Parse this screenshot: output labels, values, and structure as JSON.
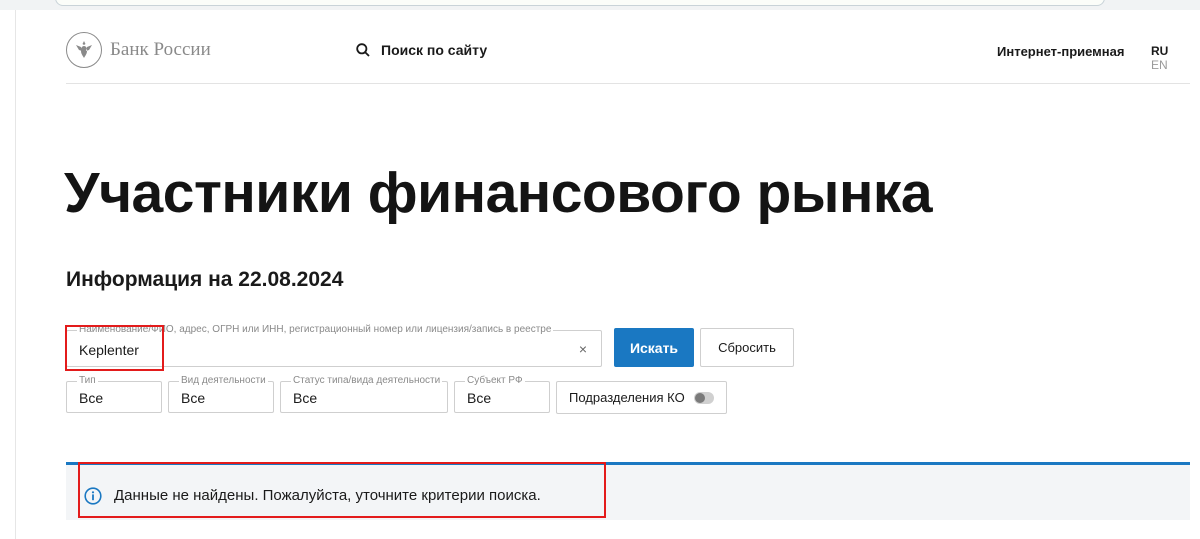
{
  "header": {
    "logo_text": "Банк России",
    "search_label": "Поиск по сайту",
    "reception_label": "Интернет-приемная",
    "lang_ru": "RU",
    "lang_en": "EN"
  },
  "page": {
    "title": "Участники финансового рынка",
    "info_date": "Информация на 22.08.2024"
  },
  "search": {
    "label": "Наименование/ФИО, адрес, ОГРН или ИНН, регистрационный номер или лицензия/запись в реестре",
    "value": "Keplenter",
    "clear_glyph": "×",
    "submit_label": "Искать",
    "reset_label": "Сбросить"
  },
  "filters": {
    "type": {
      "label": "Тип",
      "value": "Все"
    },
    "activity": {
      "label": "Вид деятельности",
      "value": "Все"
    },
    "status": {
      "label": "Статус типа/вида деятельности",
      "value": "Все"
    },
    "subject": {
      "label": "Субъект РФ",
      "value": "Все"
    },
    "subdivisions": {
      "label": "Подразделения КО",
      "enabled": false
    }
  },
  "result": {
    "message": "Данные не найдены. Пожалуйста, уточните критерии поиска."
  },
  "colors": {
    "accent": "#1a78c2",
    "highlight": "#e31b1b"
  }
}
